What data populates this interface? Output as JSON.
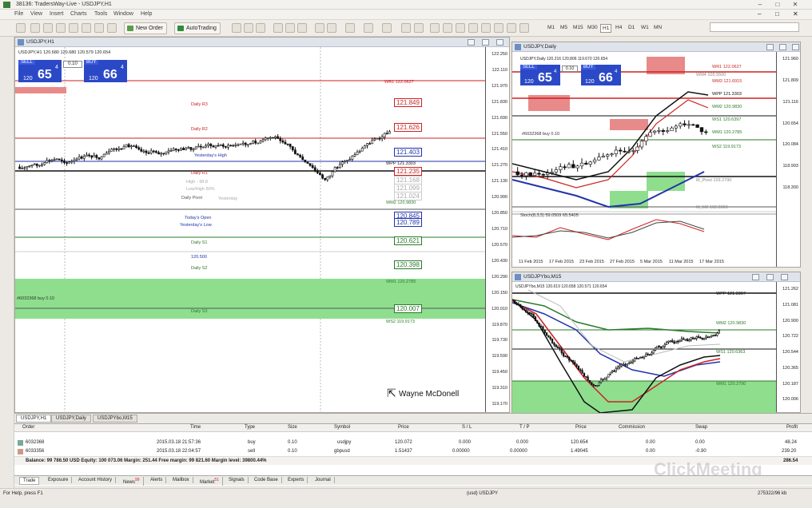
{
  "titlebar": {
    "title": "38136: TradersWay-Live - USDJPY,H1"
  },
  "menu": [
    "File",
    "View",
    "Insert",
    "Charts",
    "Tools",
    "Window",
    "Help"
  ],
  "toolbar": {
    "new_order": "New Order",
    "autotrading": "AutoTrading",
    "timeframes": [
      "M1",
      "M5",
      "M15",
      "M30",
      "H1",
      "H4",
      "D1",
      "W1",
      "MN"
    ],
    "active_timeframe": "H1"
  },
  "charts": {
    "h1": {
      "caption": "USDJPY,H1",
      "info": "USDJPY,H1  120.680 120.680 120.579 120.654",
      "sell_label": "SELL",
      "buy_label": "BUY",
      "lot": "0.10",
      "sell_small": "120",
      "sell_big": "65",
      "sell_sup": "4",
      "buy_small": "120",
      "buy_big": "66",
      "buy_sup": "4",
      "axis": [
        "122.250",
        "122.110",
        "121.970",
        "121.830",
        "121.690",
        "121.550",
        "121.410",
        "121.270",
        "121.130",
        "120.990",
        "120.850",
        "120.710",
        "120.570",
        "120.430",
        "120.290",
        "120.150",
        "120.010",
        "119.870",
        "119.730",
        "119.590",
        "119.450",
        "119.310",
        "119.170"
      ],
      "current_price": "120.654",
      "levels": {
        "wr1": "WR1 122.0627",
        "daily_r3": "Daily R3",
        "daily_r2": "Daily R2",
        "yesterday_high": "Yesterday's High",
        "wpp": "WPP 121.3303",
        "daily_r1": "Daily R1",
        "high": "High - 98.8",
        "lowhigh": "Low/High 50%",
        "daily_pivot": "Daily Pivot",
        "yesterday_label": "Yesterday",
        "wm2": "WM2 120.9830",
        "todays_open": "Today's Open",
        "yesterdays_low": "Yesterday's Low",
        "daily_s1": "Daily S1",
        "s1_value": "120.500",
        "daily_s2": "Daily S2",
        "wm1": "WM1 120.2785",
        "daily_s3": "Daily S3",
        "ws2": "WS2 119.9173",
        "order_line": "#6032368 buy 0.10"
      },
      "boxes": [
        "121.849",
        "121.626",
        "121.403",
        "121.235",
        "121.168",
        "121.099",
        "121.024",
        "120.845",
        "120.789",
        "120.621",
        "120.398",
        "120.007"
      ]
    },
    "daily": {
      "caption": "USDJPY,Daily",
      "info": "USDJPY,Daily  120.216 120.806 119.670 120.654",
      "sell_small": "120",
      "sell_big": "65",
      "sell_sup": "4",
      "buy_small": "120",
      "buy_big": "66",
      "buy_sup": "4",
      "lot": "0.10",
      "axis": [
        "121.960",
        "121.809",
        "121.116",
        "120.654",
        "120.084",
        "118.993",
        "118.300"
      ],
      "levels": [
        "WR1 122.0627",
        "WM4 105.5500",
        "WM3 121.6915",
        "WPP 121.3303",
        "WM2 120.9830",
        "WS1 120.6397",
        "WM1 120.2785",
        "WS2 119.9173",
        "M_Pivot 103.2790",
        "M_M2 102.2800"
      ],
      "stoch": "Stoch(8,3,5) 59.0509 65.5405",
      "order_line": "#6032368 buy 0.10",
      "stoch_axis": [
        "100",
        "80",
        "20",
        "0"
      ],
      "dates": [
        "11 Feb 2015",
        "17 Feb 2015",
        "23 Feb 2015",
        "27 Feb 2015",
        "5 Mar 2015",
        "11 Mar 2015",
        "17 Mar 2015"
      ]
    },
    "m15": {
      "caption": "USDJPYbo,M15",
      "info": "USDJPYbo,M15  120.619 120.658 120.571 120.654",
      "axis": [
        "121.262",
        "121.081",
        "120.900",
        "120.722",
        "120.544",
        "120.365",
        "120.187",
        "120.006"
      ],
      "current_price": "120.633",
      "levels": [
        "WPP 121.3307",
        "WM2 120.9830",
        "WS1 120.6363",
        "WM1 120.2790"
      ]
    }
  },
  "watermark_name": "Wayne McDonell",
  "chart_tabs": [
    "USDJPY,H1",
    "USDJPY,Daily",
    "USDJPYbo,M15"
  ],
  "terminal": {
    "headers": [
      "Order",
      "Time",
      "Type",
      "Size",
      "Symbol",
      "Price",
      "S / L",
      "T / P",
      "Price",
      "Commission",
      "Swap",
      "Profit"
    ],
    "rows": [
      [
        "6032368",
        "2015.03.18 21:57:36",
        "buy",
        "0.10",
        "usdjpy",
        "120.072",
        "0.000",
        "0.000",
        "120.654",
        "0.00",
        "0.00",
        "48.24"
      ],
      [
        "6033356",
        "2015.03.18 22:04:57",
        "sell",
        "0.10",
        "gbpusd",
        "1.51437",
        "0.00000",
        "0.00000",
        "1.49045",
        "0.00",
        "-0.90",
        "239.20"
      ]
    ],
    "balance": "Balance: 99 786.50 USD  Equity: 100 073.06  Margin: 251.44  Free margin: 99 821.60  Margin level: 39800.44%",
    "total_profit": "286.54"
  },
  "bottom_tabs": [
    "Trade",
    "Exposure",
    "Account History",
    "News",
    "Alerts",
    "Mailbox",
    "Market",
    "Signals",
    "Code Base",
    "Experts",
    "Journal"
  ],
  "news_badge": "99",
  "market_badge": "51",
  "status": {
    "help": "For Help, press F1",
    "symbol": "(usd) USDJPY",
    "traffic": "275322/96 kb"
  },
  "brand": "ClickMeeting"
}
